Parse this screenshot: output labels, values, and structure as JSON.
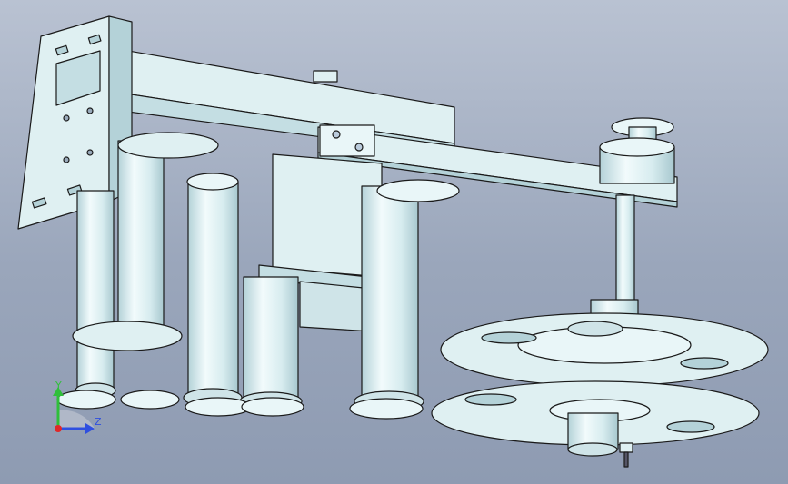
{
  "triad": {
    "y_label": "Y",
    "z_label": "Z"
  },
  "colors": {
    "background_top": "#b9c2d2",
    "background_bottom": "#8e9bb2",
    "part_fill": "#dff0f2",
    "part_shade": "#b4d2d8",
    "edge": "#1a1a1a",
    "axis_y": "#2fbf3a",
    "axis_z": "#2f4fe0",
    "axis_x": "#e02828"
  }
}
